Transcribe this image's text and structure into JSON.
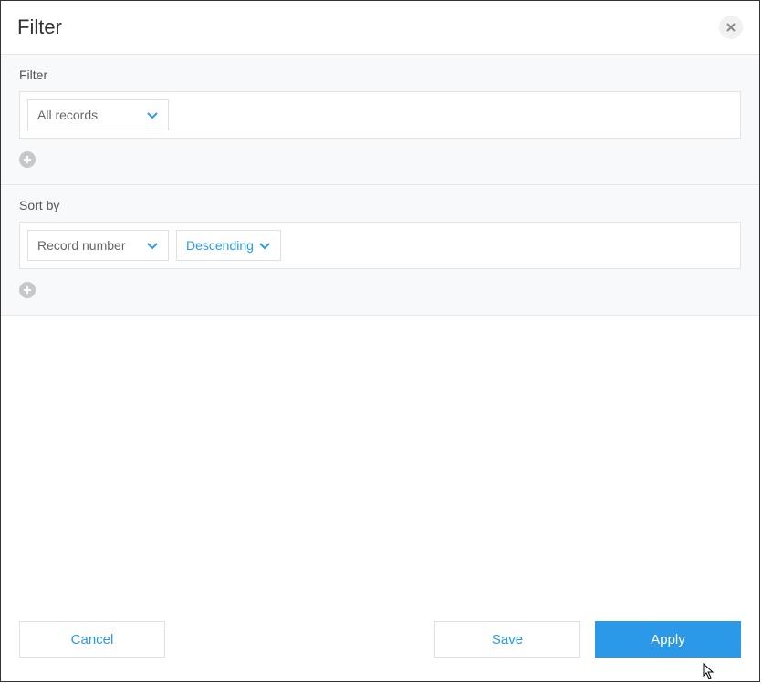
{
  "dialog": {
    "title": "Filter"
  },
  "filter": {
    "label": "Filter",
    "selected": "All records"
  },
  "sort": {
    "label": "Sort by",
    "field": "Record number",
    "direction": "Descending"
  },
  "buttons": {
    "cancel": "Cancel",
    "save": "Save",
    "apply": "Apply"
  }
}
